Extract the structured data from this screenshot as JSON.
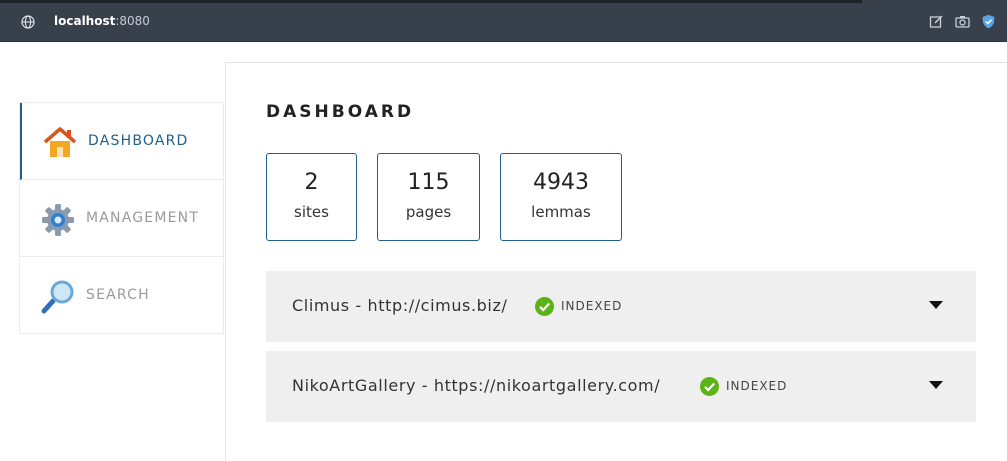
{
  "browser": {
    "url_host": "localhost",
    "url_port": ":8080",
    "icons": [
      "globe-icon",
      "edit-icon",
      "camera-icon",
      "shield-icon"
    ]
  },
  "sidebar": {
    "items": [
      {
        "label": "DASHBOARD",
        "icon": "house-icon",
        "active": true
      },
      {
        "label": "MANAGEMENT",
        "icon": "gear-icon",
        "active": false
      },
      {
        "label": "SEARCH",
        "icon": "magnifier-icon",
        "active": false
      }
    ]
  },
  "page": {
    "title": "DASHBOARD"
  },
  "stats": [
    {
      "value": "2",
      "label": "sites"
    },
    {
      "value": "115",
      "label": "pages"
    },
    {
      "value": "4943",
      "label": "lemmas"
    }
  ],
  "sites": [
    {
      "title": "Climus - http://cimus.biz/",
      "status": "INDEXED",
      "status_color": "#5bb318"
    },
    {
      "title": "NikoArtGallery - https://nikoartgallery.com/",
      "status": "INDEXED",
      "status_color": "#5bb318"
    }
  ],
  "colors": {
    "accent": "#1f5f8b",
    "browser_bar": "#37404b",
    "row_bg": "#efefef"
  }
}
